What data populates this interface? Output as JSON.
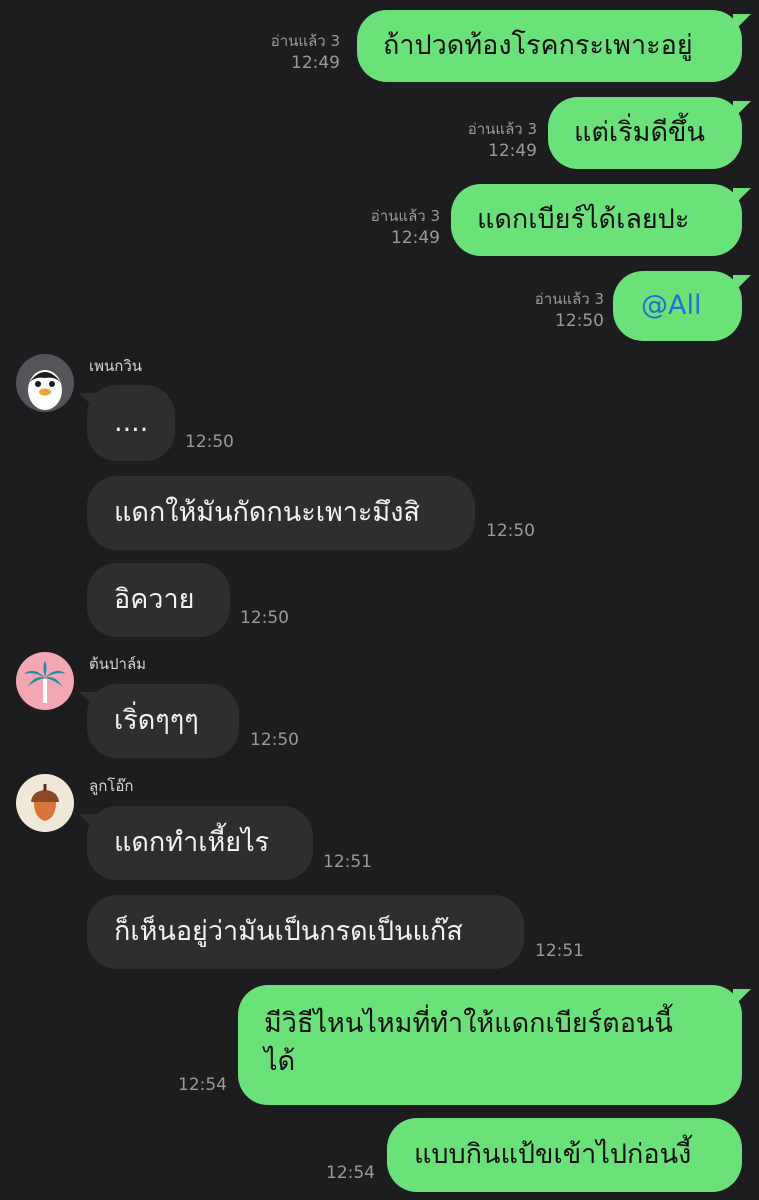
{
  "outgoing": [
    {
      "text": "ถ้าปวดท้องโรคกระเพาะอยู่",
      "read": "อ่านแล้ว 3",
      "time": "12:49"
    },
    {
      "text": "แต่เริ่มดีขึ้น",
      "read": "อ่านแล้ว 3",
      "time": "12:49"
    },
    {
      "text": "แดกเบียร์ได้เลยปะ",
      "read": "อ่านแล้ว 3",
      "time": "12:49"
    },
    {
      "text": "@All",
      "read": "อ่านแล้ว 3",
      "time": "12:50"
    },
    {
      "text_line1": "มีวิธีไหนไหมที่ทำให้แดกเบียร์ตอนนี้",
      "text_line2": "ได้",
      "time": "12:54"
    },
    {
      "text": "แบบกินแป้ขเข้าไปก่อนงี้",
      "time": "12:54"
    }
  ],
  "groups": [
    {
      "sender": "เพนกวิน",
      "avatar_icon": "penguin-icon",
      "messages": [
        {
          "text": "....",
          "time": "12:50"
        },
        {
          "text": "แดกให้มันกัดกนะเพาะมึงสิ",
          "time": "12:50"
        },
        {
          "text": "อิควาย",
          "time": "12:50"
        }
      ]
    },
    {
      "sender": "ต้นปาล์ม",
      "avatar_icon": "palm-tree-icon",
      "messages": [
        {
          "text": "เริ่ดๆๆๆ",
          "time": "12:50"
        }
      ]
    },
    {
      "sender": "ลูกโอ๊ก",
      "avatar_icon": "acorn-icon",
      "messages": [
        {
          "text": "แดกทำเหี้ยไร",
          "time": "12:51"
        },
        {
          "text": "ก็เห็นอยู่ว่ามันเป็นกรดเป็นแก๊ส",
          "time": "12:51"
        }
      ]
    }
  ],
  "colors": {
    "background": "#1d1d1f",
    "outgoing_bubble": "#6be17a",
    "incoming_bubble": "#2e2e30",
    "mention": "#1f6fd6",
    "meta_text": "#9a9a9a"
  }
}
